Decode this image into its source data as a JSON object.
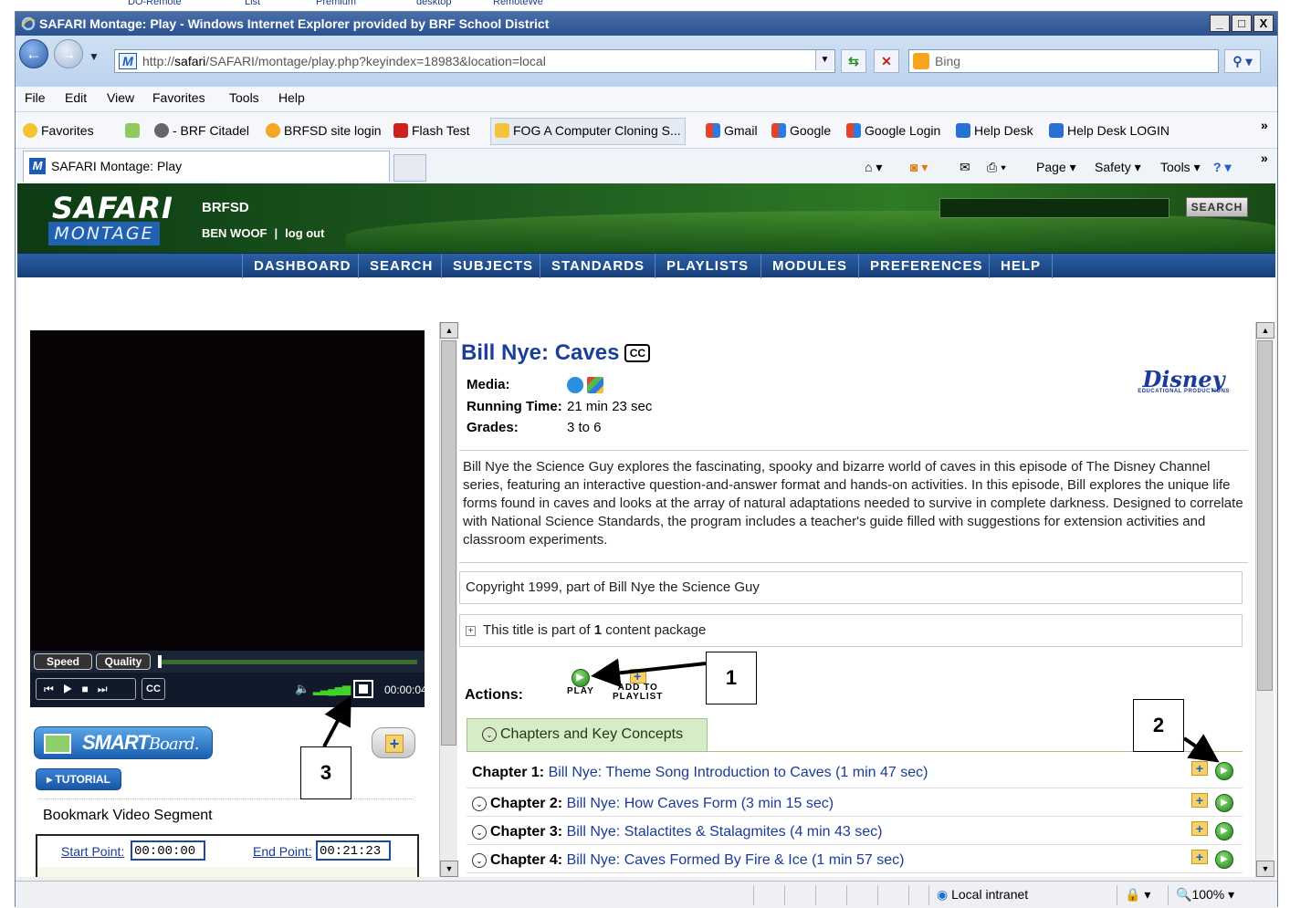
{
  "desktop": {
    "strip_labels": [
      "DO-Remote",
      "List",
      "Premium",
      "desktop",
      "RemoteWe"
    ]
  },
  "window": {
    "title": "SAFARI Montage: Play - Windows Internet Explorer provided by BRF School District",
    "controls": [
      "_",
      "□",
      "X"
    ]
  },
  "address_bar": {
    "url_prefix": "http://",
    "url_host": "safari",
    "url_path": "/SAFARI/montage/play.php?keyindex=18983&location=local",
    "search_placeholder": "Bing"
  },
  "menu": [
    "File",
    "Edit",
    "View",
    "Favorites",
    "Tools",
    "Help"
  ],
  "favorites_bar": {
    "favorites_label": "Favorites",
    "items": [
      "- BRF Citadel",
      "BRFSD site login",
      "Flash Test",
      "FOG A Computer Cloning S...",
      "Gmail",
      "Google",
      "Google Login",
      "Help Desk",
      "Help Desk LOGIN"
    ],
    "more": "»"
  },
  "tab": {
    "label": "SAFARI Montage: Play"
  },
  "command_bar": {
    "page": "Page",
    "safety": "Safety",
    "tools": "Tools"
  },
  "site": {
    "logo_top": "SAFARI",
    "logo_bottom": "MONTAGE",
    "org": "BRFSD",
    "user": "BEN WOOF",
    "logout": "log out",
    "search_button": "SEARCH",
    "nav": [
      "DASHBOARD",
      "SEARCH",
      "SUBJECTS",
      "STANDARDS",
      "PLAYLISTS",
      "MODULES",
      "PREFERENCES",
      "HELP"
    ]
  },
  "player": {
    "speed": "Speed",
    "quality": "Quality",
    "cc": "CC",
    "time": "00:00:04",
    "progress": 0
  },
  "left_panel": {
    "smart_board": "SMART",
    "smart_board_2": "Board.",
    "tutorial": "TUTORIAL",
    "bookmark_title": "Bookmark Video Segment",
    "start_label": "Start Point:",
    "start_value": "00:00:00",
    "end_label": "End Point:",
    "end_value": "00:21:23"
  },
  "title_info": {
    "title": "Bill Nye: Caves",
    "cc_badge": "CC",
    "media_label": "Media:",
    "running_label": "Running Time:",
    "running_value": "21 min 23 sec",
    "grades_label": "Grades:",
    "grades_value": "3 to 6",
    "publisher_logo": "Disney",
    "publisher_sub": "EDUCATIONAL PRODUCTIONS",
    "description": "Bill Nye the Science Guy explores the fascinating, spooky and bizarre world of caves in this episode of The Disney Channel series, featuring an interactive question-and-answer format and hands-on activities. In this episode, Bill explores the unique life forms found in caves and looks at the array of natural adaptations needed to survive in complete darkness. Designed to correlate with National Science Standards, the program includes a teacher's guide filled with suggestions for extension activities and classroom experiments.",
    "copyright": "Copyright 1999, part of Bill Nye the Science Guy",
    "package_pre": "This title is part of ",
    "package_count": "1",
    "package_post": " content package",
    "actions_label": "Actions:",
    "play_label": "PLAY",
    "add_label_1": "ADD TO",
    "add_label_2": "PLAYLIST"
  },
  "chapters": {
    "tab_label": "Chapters and Key Concepts",
    "items": [
      {
        "prefix": "Chapter 1:",
        "text": " Bill Nye: Theme Song Introduction to Caves (1 min 47 sec)"
      },
      {
        "prefix": "Chapter 2:",
        "text": " Bill Nye: How Caves Form (3 min 15 sec)"
      },
      {
        "prefix": "Chapter 3:",
        "text": " Bill Nye: Stalactites & Stalagmites (4 min 43 sec)"
      },
      {
        "prefix": "Chapter 4:",
        "text": " Bill Nye: Caves Formed By Fire & Ice (1 min 57 sec)"
      }
    ]
  },
  "callouts": [
    "1",
    "2",
    "3"
  ],
  "status": {
    "zone": "Local intranet",
    "zoom": "100%"
  }
}
